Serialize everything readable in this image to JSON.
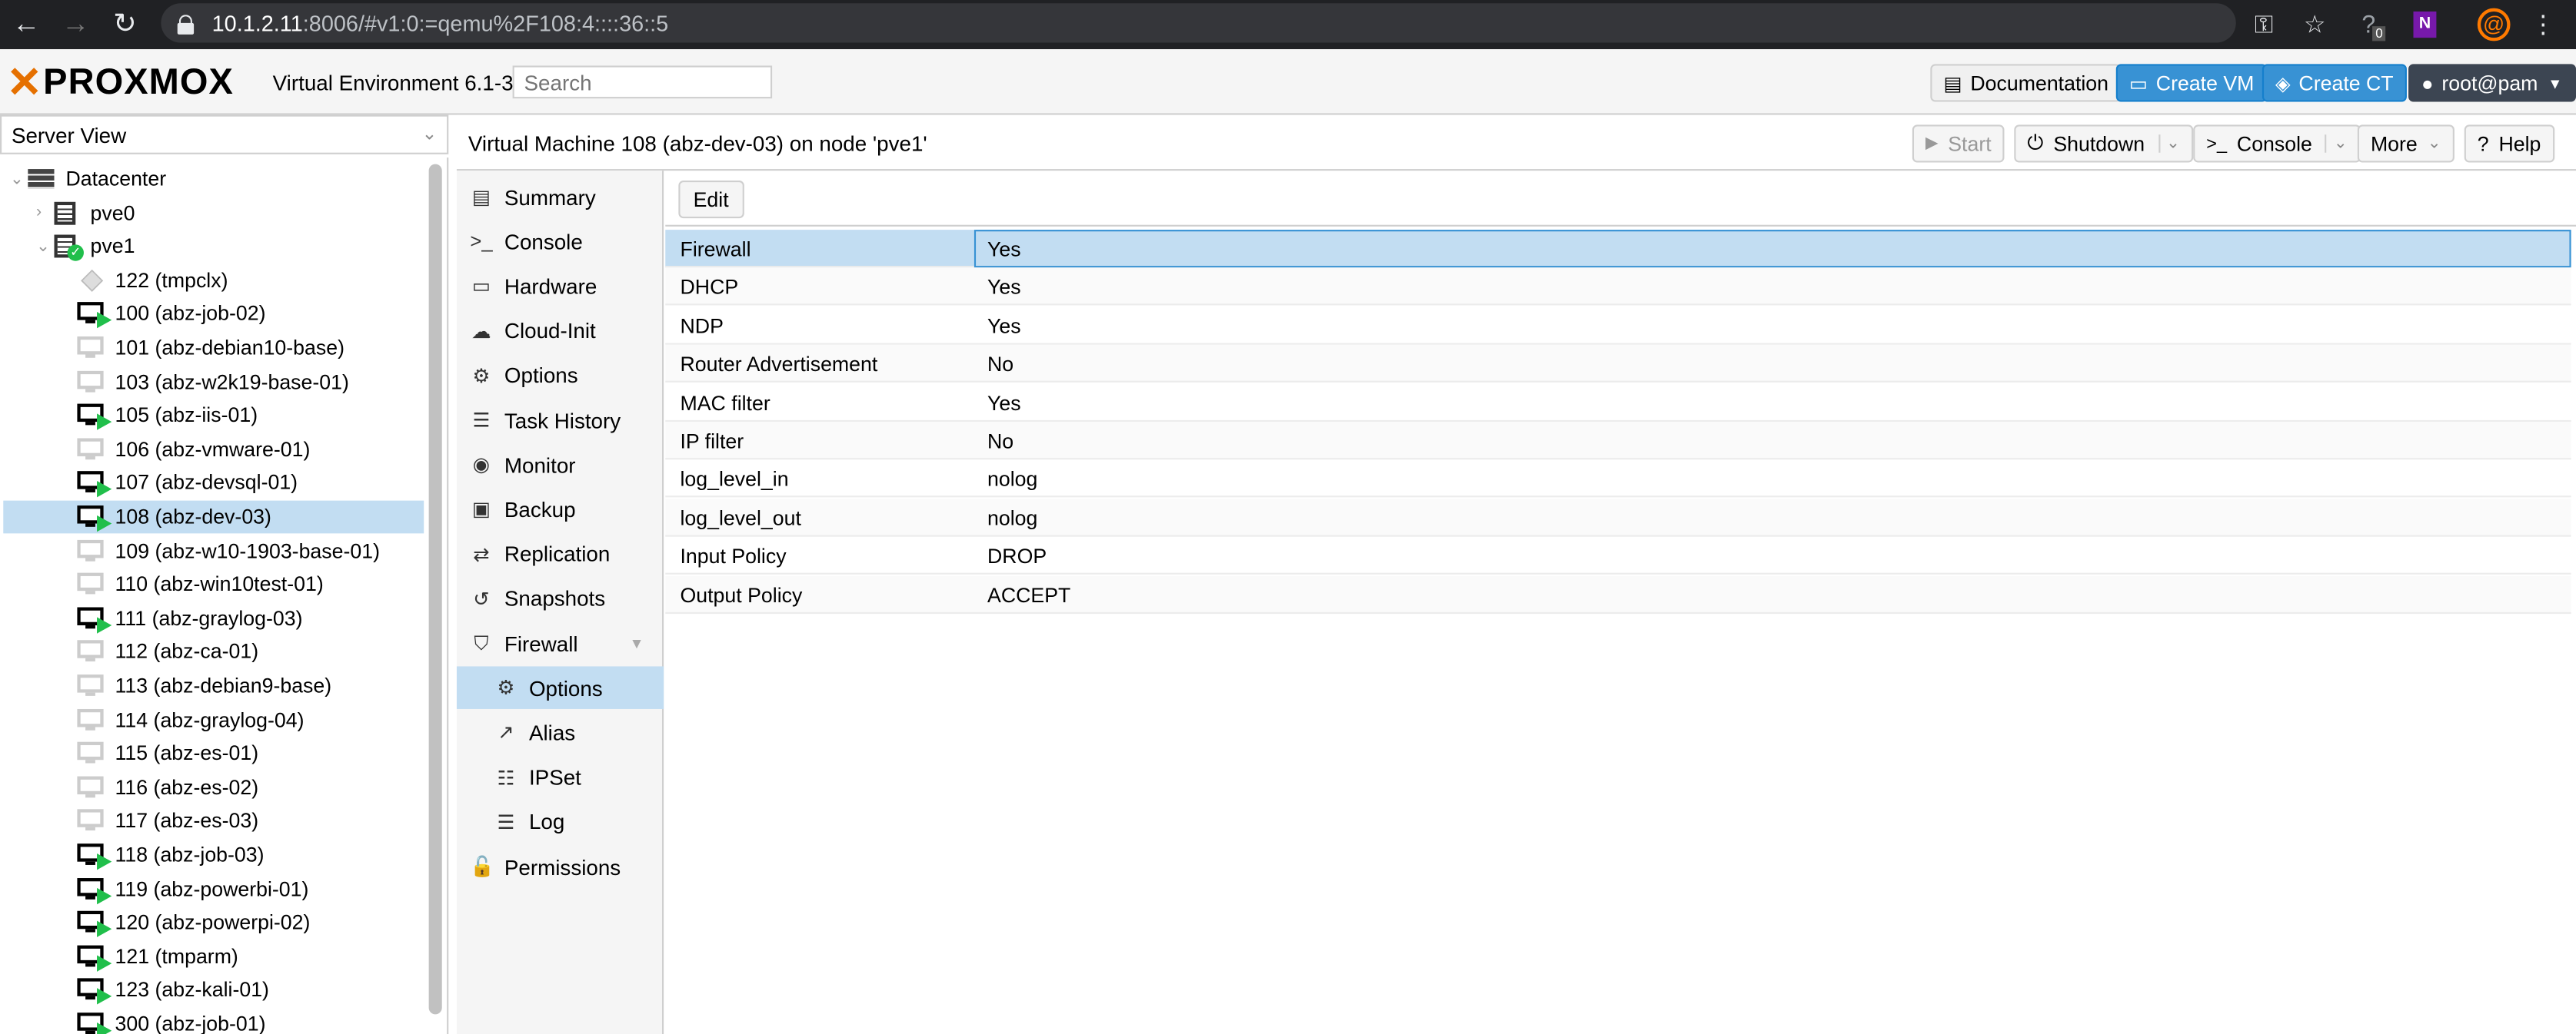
{
  "browser": {
    "url_host": "10.1.2.11",
    "url_rest": ":8006/#v1:0:=qemu%2F108:4::::36::5",
    "icons": [
      "back-icon",
      "forward-icon",
      "reload-icon",
      "lock-icon",
      "key-icon",
      "star-icon",
      "extension-icon",
      "onenote-icon",
      "profile-icon",
      "menu-icon"
    ],
    "extension_badge": "0"
  },
  "header": {
    "logo": "PROXMOX",
    "version": "Virtual Environment 6.1-3",
    "search_placeholder": "Search",
    "documentation": "Documentation",
    "create_vm": "Create VM",
    "create_ct": "Create CT",
    "user": "root@pam"
  },
  "sidebar": {
    "view": "Server View",
    "datacenter": "Datacenter",
    "nodes": [
      "pve0",
      "pve1"
    ],
    "guests": [
      {
        "label": "122 (tmpclx)",
        "type": "ct",
        "running": false
      },
      {
        "label": "100 (abz-job-02)",
        "type": "vm",
        "running": true
      },
      {
        "label": "101 (abz-debian10-base)",
        "type": "vm",
        "running": false
      },
      {
        "label": "103 (abz-w2k19-base-01)",
        "type": "vm",
        "running": false
      },
      {
        "label": "105 (abz-iis-01)",
        "type": "vm",
        "running": true
      },
      {
        "label": "106 (abz-vmware-01)",
        "type": "vm",
        "running": false
      },
      {
        "label": "107 (abz-devsql-01)",
        "type": "vm",
        "running": true
      },
      {
        "label": "108 (abz-dev-03)",
        "type": "vm",
        "running": true,
        "selected": true
      },
      {
        "label": "109 (abz-w10-1903-base-01)",
        "type": "vm",
        "running": false
      },
      {
        "label": "110 (abz-win10test-01)",
        "type": "vm",
        "running": false
      },
      {
        "label": "111 (abz-graylog-03)",
        "type": "vm",
        "running": true
      },
      {
        "label": "112 (abz-ca-01)",
        "type": "vm",
        "running": false
      },
      {
        "label": "113 (abz-debian9-base)",
        "type": "vm",
        "running": false
      },
      {
        "label": "114 (abz-graylog-04)",
        "type": "vm",
        "running": false
      },
      {
        "label": "115 (abz-es-01)",
        "type": "vm",
        "running": false
      },
      {
        "label": "116 (abz-es-02)",
        "type": "vm",
        "running": false
      },
      {
        "label": "117 (abz-es-03)",
        "type": "vm",
        "running": false
      },
      {
        "label": "118 (abz-job-03)",
        "type": "vm",
        "running": true
      },
      {
        "label": "119 (abz-powerbi-01)",
        "type": "vm",
        "running": true
      },
      {
        "label": "120 (abz-powerpi-02)",
        "type": "vm",
        "running": true
      },
      {
        "label": "121 (tmparm)",
        "type": "vm",
        "running": true
      },
      {
        "label": "123 (abz-kali-01)",
        "type": "vm",
        "running": true
      },
      {
        "label": "300 (abz-job-01)",
        "type": "vm",
        "running": true
      }
    ]
  },
  "content": {
    "title": "Virtual Machine 108 (abz-dev-03) on node 'pve1'",
    "start": "Start",
    "shutdown": "Shutdown",
    "console": "Console",
    "more": "More",
    "help": "Help"
  },
  "menu": [
    {
      "label": "Summary",
      "icon": "book-icon",
      "glyph": "▤"
    },
    {
      "label": "Console",
      "icon": "terminal-icon",
      "glyph": ">_"
    },
    {
      "label": "Hardware",
      "icon": "desktop-icon",
      "glyph": "▭"
    },
    {
      "label": "Cloud-Init",
      "icon": "cloud-icon",
      "glyph": "☁"
    },
    {
      "label": "Options",
      "icon": "gear-icon",
      "glyph": "⚙"
    },
    {
      "label": "Task History",
      "icon": "list-icon",
      "glyph": "☰"
    },
    {
      "label": "Monitor",
      "icon": "eye-icon",
      "glyph": "◉"
    },
    {
      "label": "Backup",
      "icon": "floppy-icon",
      "glyph": "▣"
    },
    {
      "label": "Replication",
      "icon": "retweet-icon",
      "glyph": "⇄"
    },
    {
      "label": "Snapshots",
      "icon": "history-icon",
      "glyph": "↺"
    },
    {
      "label": "Firewall",
      "icon": "shield-icon",
      "glyph": "⛉"
    },
    {
      "label": "Options",
      "icon": "gear-icon",
      "glyph": "⚙",
      "sub": true,
      "selected": true
    },
    {
      "label": "Alias",
      "icon": "external-link-icon",
      "glyph": "↗",
      "sub": true
    },
    {
      "label": "IPSet",
      "icon": "list-ol-icon",
      "glyph": "☷",
      "sub": true
    },
    {
      "label": "Log",
      "icon": "list-icon",
      "glyph": "☰",
      "sub": true
    },
    {
      "label": "Permissions",
      "icon": "unlock-icon",
      "glyph": "🔓"
    }
  ],
  "panel": {
    "edit": "Edit",
    "rows": [
      {
        "key": "Firewall",
        "value": "Yes"
      },
      {
        "key": "DHCP",
        "value": "Yes"
      },
      {
        "key": "NDP",
        "value": "Yes"
      },
      {
        "key": "Router Advertisement",
        "value": "No"
      },
      {
        "key": "MAC filter",
        "value": "Yes"
      },
      {
        "key": "IP filter",
        "value": "No"
      },
      {
        "key": "log_level_in",
        "value": "nolog"
      },
      {
        "key": "log_level_out",
        "value": "nolog"
      },
      {
        "key": "Input Policy",
        "value": "DROP"
      },
      {
        "key": "Output Policy",
        "value": "ACCEPT"
      }
    ]
  },
  "colors": {
    "accent": "#3892d4",
    "selection": "#c2ddf2",
    "running": "#21bf4b",
    "brand": "#e57000"
  }
}
